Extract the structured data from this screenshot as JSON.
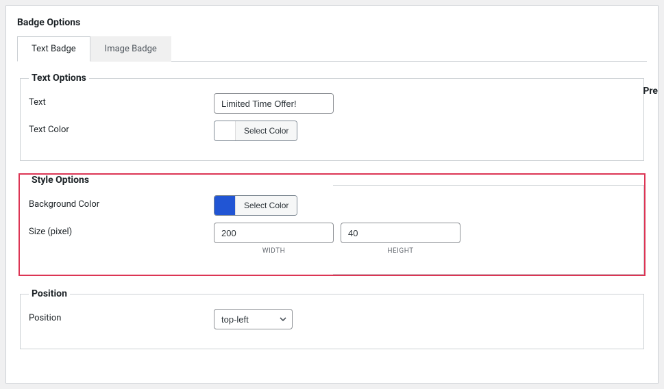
{
  "panel": {
    "title": "Badge Options"
  },
  "tabs": {
    "text_badge": "Text Badge",
    "image_badge": "Image Badge"
  },
  "text_options": {
    "legend": "Text Options",
    "text_label": "Text",
    "text_value": "Limited Time Offer!",
    "text_color_label": "Text Color",
    "text_color_swatch": "#ffffff",
    "select_color_label": "Select Color"
  },
  "style_options": {
    "legend": "Style Options",
    "bg_color_label": "Background Color",
    "bg_color_swatch": "#2155d4",
    "select_color_label": "Select Color",
    "size_label": "Size (pixel)",
    "width_value": "200",
    "height_value": "40",
    "width_sublabel": "WIDTH",
    "height_sublabel": "HEIGHT"
  },
  "position": {
    "legend": "Position",
    "label": "Position",
    "selected": "top-left"
  },
  "preview": {
    "label": "Pre"
  }
}
